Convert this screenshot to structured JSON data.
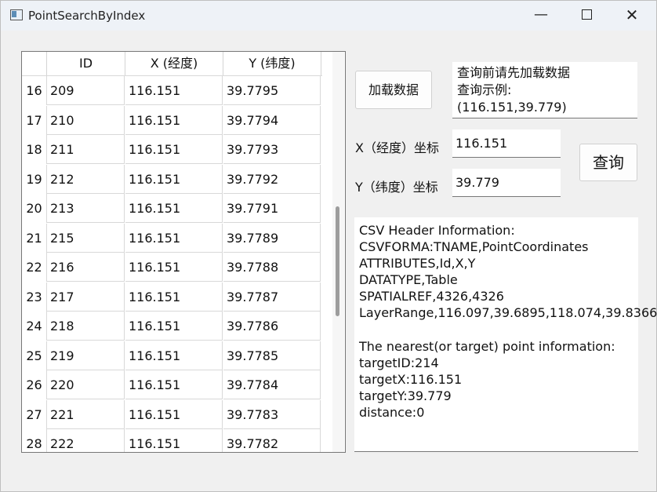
{
  "window": {
    "title": "PointSearchByIndex",
    "minimize": "—",
    "maximize": "□",
    "close": "✕",
    "icon": "app-window-icon"
  },
  "table": {
    "headers": [
      "ID",
      "X (经度)",
      "Y (纬度)"
    ],
    "rows": [
      {
        "num": "16",
        "id": "209",
        "x": "116.151",
        "y": "39.7795"
      },
      {
        "num": "17",
        "id": "210",
        "x": "116.151",
        "y": "39.7794"
      },
      {
        "num": "18",
        "id": "211",
        "x": "116.151",
        "y": "39.7793"
      },
      {
        "num": "19",
        "id": "212",
        "x": "116.151",
        "y": "39.7792"
      },
      {
        "num": "20",
        "id": "213",
        "x": "116.151",
        "y": "39.7791"
      },
      {
        "num": "21",
        "id": "215",
        "x": "116.151",
        "y": "39.7789"
      },
      {
        "num": "22",
        "id": "216",
        "x": "116.151",
        "y": "39.7788"
      },
      {
        "num": "23",
        "id": "217",
        "x": "116.151",
        "y": "39.7787"
      },
      {
        "num": "24",
        "id": "218",
        "x": "116.151",
        "y": "39.7786"
      },
      {
        "num": "25",
        "id": "219",
        "x": "116.151",
        "y": "39.7785"
      },
      {
        "num": "26",
        "id": "220",
        "x": "116.151",
        "y": "39.7784"
      },
      {
        "num": "27",
        "id": "221",
        "x": "116.151",
        "y": "39.7783"
      },
      {
        "num": "28",
        "id": "222",
        "x": "116.151",
        "y": "39.7782"
      }
    ]
  },
  "buttons": {
    "load": "加载数据",
    "query": "查询"
  },
  "hint": {
    "line1": "查询前请先加载数据",
    "line2": "查询示例:",
    "line3": "(116.151,39.779)"
  },
  "coords": {
    "x_label": "X（经度）坐标",
    "x_value": "116.151",
    "y_label": "Y（纬度）坐标",
    "y_value": "39.779"
  },
  "output": {
    "text": "CSV Header Information:\nCSVFORMA:TNAME,PointCoordinates\nATTRIBUTES,Id,X,Y\nDATATYPE,Table\nSPATIALREF,4326,4326\nLayerRange,116.097,39.6895,118.074,39.8366\n\nThe nearest(or target) point information:\ntargetID:214\ntargetX:116.151\ntargetY:39.779\ndistance:0"
  }
}
